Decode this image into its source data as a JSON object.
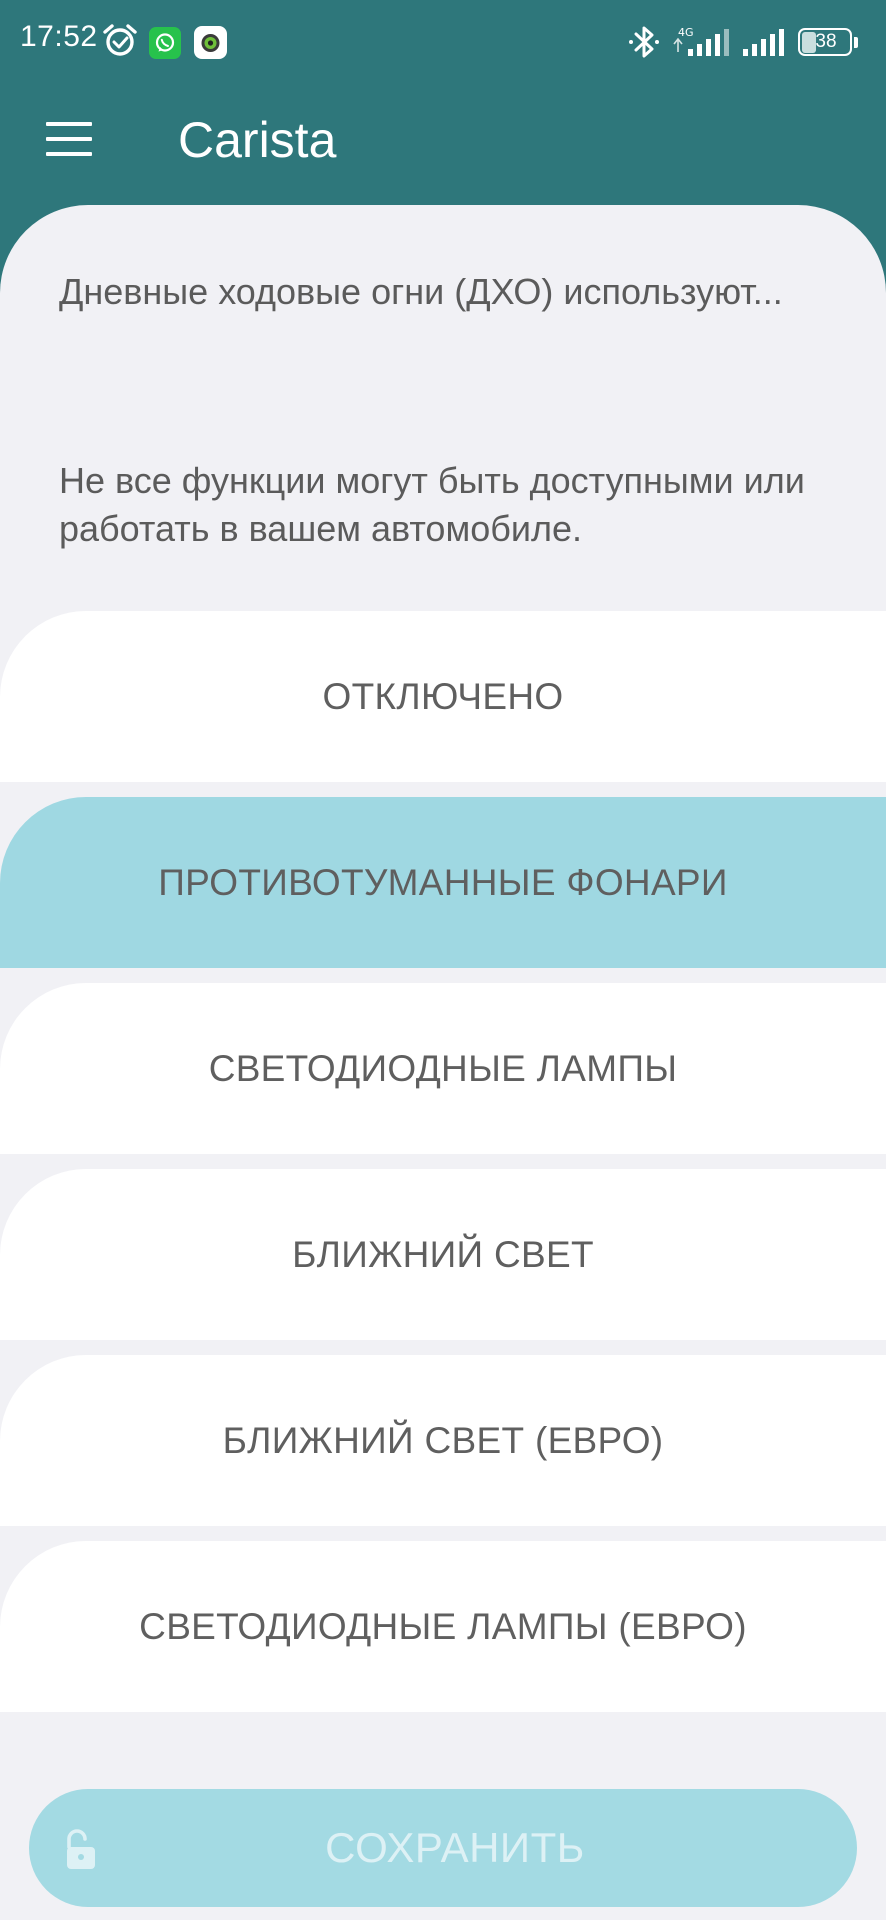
{
  "status_bar": {
    "time": "17:52",
    "battery_level": "38",
    "network_type": "4G",
    "icons": [
      "alarm-icon",
      "whatsapp-icon",
      "camera-app-icon",
      "bluetooth-icon",
      "signal-icon",
      "battery-icon"
    ]
  },
  "app_bar": {
    "title": "Carista",
    "menu_icon": "hamburger-menu-icon"
  },
  "content": {
    "setting_name": "Дневные ходовые огни (ДХО) используют...",
    "disclaimer": "Не все функции могут быть доступными или работать в вашем автомобиле."
  },
  "options": [
    {
      "label": "ОТКЛЮЧЕНО",
      "selected": false
    },
    {
      "label": "ПРОТИВОТУМАННЫЕ ФОНАРИ",
      "selected": true
    },
    {
      "label": "СВЕТОДИОДНЫЕ ЛАМПЫ",
      "selected": false
    },
    {
      "label": "БЛИЖНИЙ СВЕТ",
      "selected": false
    },
    {
      "label": "БЛИЖНИЙ СВЕТ (ЕВРО)",
      "selected": false
    },
    {
      "label": "СВЕТОДИОДНЫЕ ЛАМПЫ (ЕВРО)",
      "selected": false
    }
  ],
  "save_button": {
    "label": "СОХРАНИТЬ",
    "icon": "unlock-icon",
    "enabled": false
  },
  "colors": {
    "header": "#2e777b",
    "sheet_background": "#f1f1f5",
    "option_background": "#ffffff",
    "option_selected": "#9fd8e2",
    "text": "#5b5b5b",
    "save_button": "#a3dae3"
  }
}
